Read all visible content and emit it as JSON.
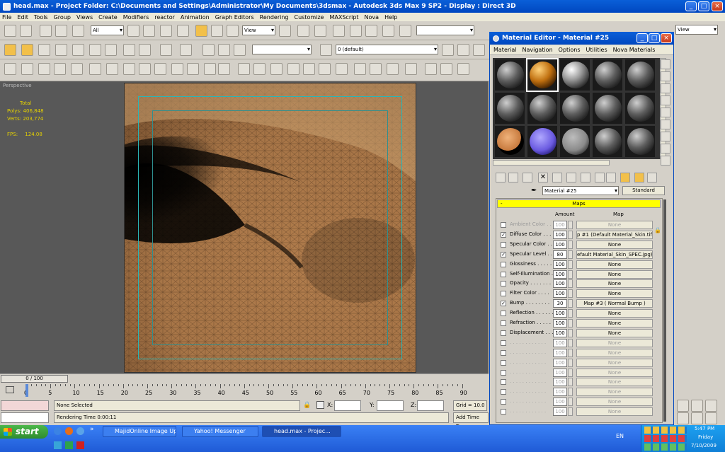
{
  "window": {
    "title": "head.max    - Project Folder: C:\\Documents and Settings\\Administrator\\My Documents\\3dsmax    - Autodesk 3ds Max 9 SP2    - Display : Direct 3D"
  },
  "menu": [
    "File",
    "Edit",
    "Tools",
    "Group",
    "Views",
    "Create",
    "Modifiers",
    "reactor",
    "Animation",
    "Graph Editors",
    "Rendering",
    "Customize",
    "MAXScript",
    "Nova",
    "Help"
  ],
  "toolbar": {
    "filter": "All",
    "ref_coord": "View",
    "layer": "0 (default)",
    "view_right": "View"
  },
  "viewport": {
    "label": "Perspective",
    "stats_header": "Total",
    "polys_label": "Polys:",
    "polys": "406,848",
    "verts_label": "Verts:",
    "verts": "203,774",
    "fps_label": "FPS:",
    "fps": "124.08"
  },
  "timeline": {
    "frame": "0 / 100",
    "ticks": [
      "0",
      "5",
      "10",
      "15",
      "20",
      "25",
      "30",
      "35",
      "40",
      "45",
      "50",
      "55",
      "60",
      "65",
      "70",
      "75",
      "80",
      "85",
      "90"
    ]
  },
  "status": {
    "selection": "None Selected",
    "render_time": "Rendering Time  0:00:11",
    "x_label": "X:",
    "y_label": "Y:",
    "z_label": "Z:",
    "grid": "Grid = 10.0",
    "add_time_tag": "Add Time Tag"
  },
  "material_editor": {
    "title": "Material Editor - Material #25",
    "menu": [
      "Material",
      "Navigation",
      "Options",
      "Utilities",
      "Nova Materials"
    ],
    "material_name": "Material #25",
    "material_type": "Standard",
    "rollout": "Maps",
    "rollout_toggle": "-",
    "col_amount": "Amount",
    "col_map": "Map",
    "maps": [
      {
        "label": "Ambient Color . . .",
        "checked": false,
        "amount": "100",
        "map": "None",
        "disabled": true
      },
      {
        "label": "Diffuse Color . . .",
        "checked": true,
        "amount": "100",
        "map": "p #1 (Default Material_Skin.tif)",
        "disabled": false
      },
      {
        "label": "Specular Color . . .",
        "checked": false,
        "amount": "100",
        "map": "None",
        "disabled": false
      },
      {
        "label": "Specular Level . .",
        "checked": true,
        "amount": "80",
        "map": "efault Material_Skin_SPEC.jpg)",
        "disabled": false
      },
      {
        "label": "Glossiness . . . . . .",
        "checked": false,
        "amount": "100",
        "map": "None",
        "disabled": false
      },
      {
        "label": "Self-Illumination . .",
        "checked": false,
        "amount": "100",
        "map": "None",
        "disabled": false
      },
      {
        "label": "Opacity . . . . . . . .",
        "checked": false,
        "amount": "100",
        "map": "None",
        "disabled": false
      },
      {
        "label": "Filter Color . . . .",
        "checked": false,
        "amount": "100",
        "map": "None",
        "disabled": false
      },
      {
        "label": "Bump . . . . . . . .",
        "checked": true,
        "amount": "30",
        "map": "Map #3  ( Normal Bump )",
        "disabled": false
      },
      {
        "label": "Reflection . . . . . .",
        "checked": false,
        "amount": "100",
        "map": "None",
        "disabled": false
      },
      {
        "label": "Refraction . . . . . .",
        "checked": false,
        "amount": "100",
        "map": "None",
        "disabled": false
      },
      {
        "label": "Displacement . . .",
        "checked": false,
        "amount": "100",
        "map": "None",
        "disabled": false
      },
      {
        "label": ". . . . . . . . . . . .",
        "checked": false,
        "amount": "100",
        "map": "None",
        "disabled": true
      },
      {
        "label": ". . . . . . . . . . . .",
        "checked": false,
        "amount": "100",
        "map": "None",
        "disabled": true
      },
      {
        "label": ". . . . . . . . . . . .",
        "checked": false,
        "amount": "100",
        "map": "None",
        "disabled": true
      },
      {
        "label": ". . . . . . . . . . . .",
        "checked": false,
        "amount": "100",
        "map": "None",
        "disabled": true
      },
      {
        "label": ". . . . . . . . . . . .",
        "checked": false,
        "amount": "100",
        "map": "None",
        "disabled": true
      },
      {
        "label": ". . . . . . . . . . . .",
        "checked": false,
        "amount": "100",
        "map": "None",
        "disabled": true
      },
      {
        "label": ". . . . . . . . . . . .",
        "checked": false,
        "amount": "100",
        "map": "None",
        "disabled": true
      },
      {
        "label": ". . . . . . . . . . . .",
        "checked": false,
        "amount": "100",
        "map": "None",
        "disabled": true
      }
    ]
  },
  "taskbar": {
    "start": "start",
    "quicklaunch_more": "»",
    "tasks": [
      "MajidOnline Image Up...",
      "Yahoo! Messenger",
      "head.max    - Projec..."
    ],
    "lang": "EN",
    "time": "5:47 PM",
    "day": "Friday",
    "date": "7/10/2009"
  }
}
